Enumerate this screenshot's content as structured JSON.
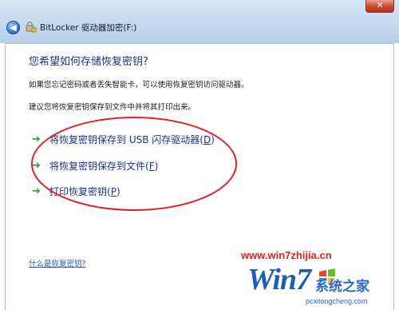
{
  "window": {
    "title": "BitLocker 驱动器加密(F:)",
    "close_glyph": "✕",
    "back_glyph": "◀"
  },
  "main": {
    "heading": "您希望如何存储恢复密钥?",
    "description": "如果您忘记密码或者丢失智能卡，可以使用恢复密钥访问驱动器。",
    "recommendation": "建议您将恢复密钥保存到文件中并将其打印出来。",
    "options": [
      {
        "text": "将恢复密钥保存到 USB 闪存驱动器(",
        "key": "D",
        "close": ")"
      },
      {
        "text": "将恢复密钥保存到文件(",
        "key": "F",
        "close": ")"
      },
      {
        "text": "打印恢复密钥(",
        "key": "P",
        "close": ")"
      }
    ],
    "help_link": "什么是恢复密钥?"
  },
  "watermark": {
    "url": "www.win7zhijia.cn",
    "logo": "Win7",
    "site_name": "系统之家",
    "site_url": "pcxitongcheng.com"
  },
  "colors": {
    "heading": "#1e3287",
    "link": "#2a57b8",
    "arrow": "#2e9d2e",
    "annotation_ellipse": "#e0202a",
    "titlebar": "#c3d9ef"
  }
}
